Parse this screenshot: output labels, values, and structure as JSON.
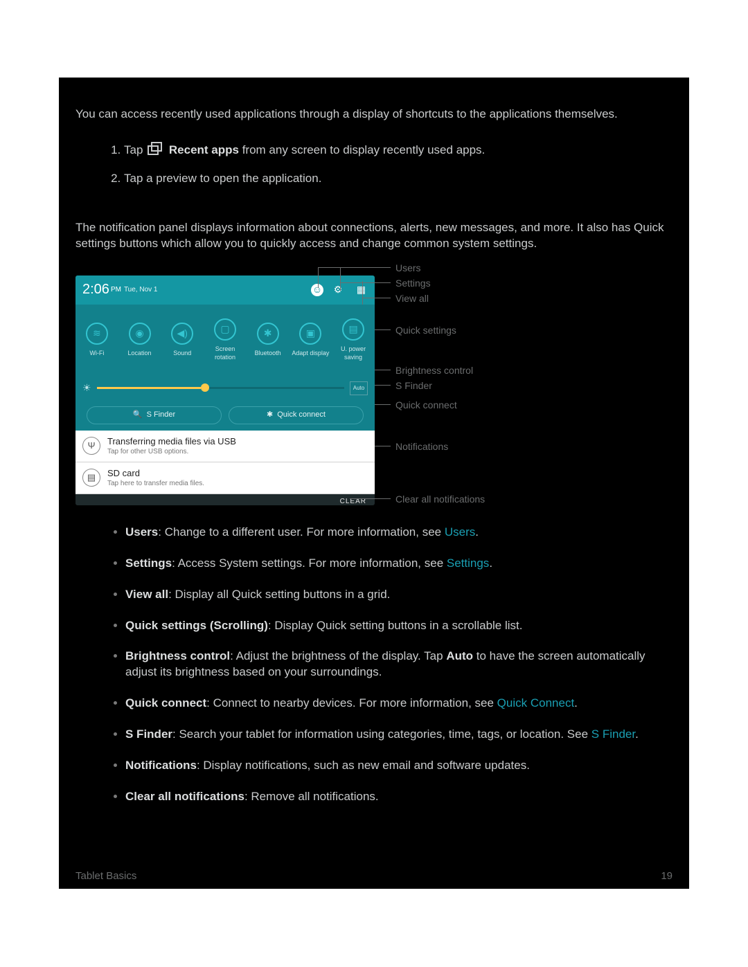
{
  "intro": "You can access recently used applications through a display of shortcuts to the applications themselves.",
  "step1_tap": "Tap",
  "step1_bold": "Recent apps",
  "step1_rest": " from any screen to display recently used apps.",
  "step2": "Tap a preview to open the application.",
  "panel_intro": "The notification panel displays information about connections, alerts, new messages, and more. It also has Quick settings buttons which allow you to quickly access and change common system settings.",
  "shot": {
    "clock": "2:06",
    "ampm": "PM",
    "date": "Tue, Nov 1",
    "qs": [
      {
        "glyph": "≋",
        "label": "Wi-Fi"
      },
      {
        "glyph": "◉",
        "label": "Location"
      },
      {
        "glyph": "◀)",
        "label": "Sound"
      },
      {
        "glyph": "▢",
        "label": "Screen rotation"
      },
      {
        "glyph": "✱",
        "label": "Bluetooth"
      },
      {
        "glyph": "▣",
        "label": "Adapt display"
      },
      {
        "glyph": "▤",
        "label": "U. power saving"
      }
    ],
    "auto": "Auto",
    "sfinder": "S Finder",
    "quickconnect": "Quick connect",
    "notif1_title": "Transferring media files via USB",
    "notif1_sub": "Tap for other USB options.",
    "notif2_title": "SD card",
    "notif2_sub": "Tap here to transfer media files.",
    "clear": "CLEAR"
  },
  "labels": {
    "users": "Users",
    "settings": "Settings",
    "viewall": "View all",
    "quicksettings": "Quick settings",
    "brightness": "Brightness control",
    "sfinder": "S Finder",
    "quickconnect": "Quick connect",
    "notifications": "Notifications",
    "clearall": "Clear all notifications"
  },
  "defs": {
    "users_term": "Users",
    "users_text": ": Change to a different user. For more information, see ",
    "users_link": "Users",
    "settings_term": "Settings",
    "settings_text": ": Access System settings. For more information, see ",
    "settings_link": "Settings",
    "viewall_term": "View all",
    "viewall_text": ": Display all Quick setting buttons in a grid.",
    "qs_term": "Quick settings (Scrolling)",
    "qs_text": ": Display Quick setting buttons in a scrollable list.",
    "bright_term": "Brightness control",
    "bright_text": ": Adjust the brightness of the display. Tap ",
    "bright_auto": "Auto",
    "bright_text2": " to have the screen automatically adjust its brightness based on your surroundings.",
    "qc_term": "Quick connect",
    "qc_text": ": Connect to nearby devices. For more information, see ",
    "qc_link": "Quick Connect",
    "sf_term": "S Finder",
    "sf_text": ": Search your tablet for information using categories, time, tags, or location. See ",
    "sf_link": "S Finder",
    "notif_term": "Notifications",
    "notif_text": ": Display notifications, such as new email and software updates.",
    "clear_term": "Clear all notifications",
    "clear_text": ": Remove all notifications."
  },
  "footer_left": "Tablet Basics",
  "footer_right": "19",
  "period": "."
}
